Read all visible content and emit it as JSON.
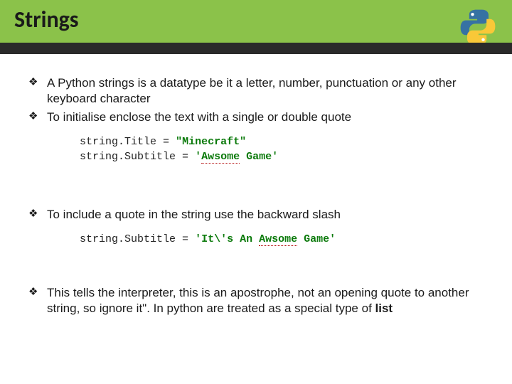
{
  "header": {
    "title": "Strings"
  },
  "bullets": {
    "b1": "A Python strings is a datatype be it a letter, number, punctuation or any other keyboard character",
    "b2": "To initialise enclose the text with a single or double quote",
    "b3": " To include a quote in the string use the backward slash",
    "b4a": " This tells the interpreter, this is an apostrophe, not an opening quote to another string, so ignore it\". In python are treated as a special type of ",
    "b4b": "list"
  },
  "code1": {
    "l1_a": "string",
    "l1_b": ".",
    "l1_c": "Title ",
    "l1_d": "= ",
    "l1_e": "\"Minecraft\"",
    "l2_a": "string",
    "l2_b": ".",
    "l2_c": "Subtitle ",
    "l2_d": "= ",
    "l2_e": "'",
    "l2_f": "Awsome",
    "l2_g": " Game'"
  },
  "code2": {
    "l1_a": "string",
    "l1_b": ".",
    "l1_c": "Subtitle ",
    "l1_d": "= ",
    "l1_e": "'It\\'s An ",
    "l1_f": "Awsome",
    "l1_g": " Game'"
  },
  "marks": {
    "diamond": "❖"
  }
}
